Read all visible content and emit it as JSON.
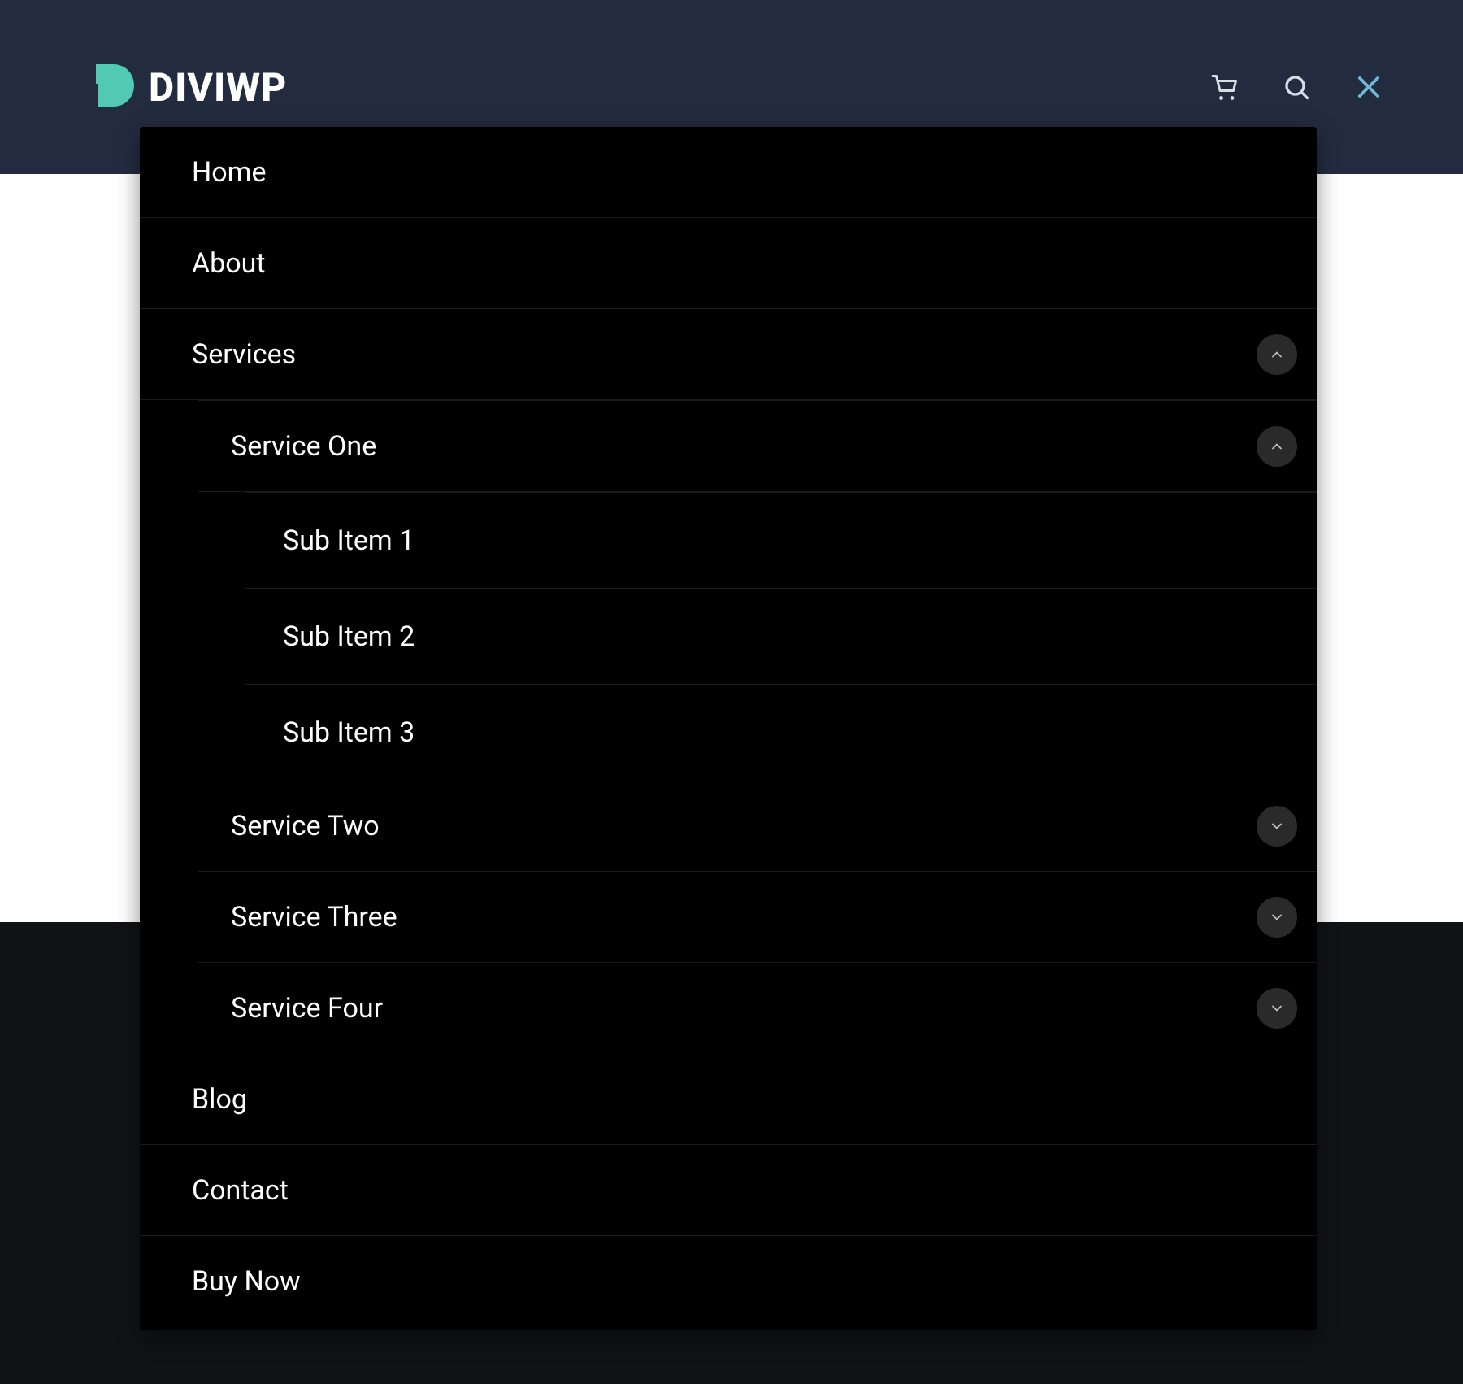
{
  "brand": {
    "name": "DIVIWP",
    "accent_color": "#52c9b3"
  },
  "header": {
    "icons": {
      "cart": "cart-icon",
      "search": "search-icon",
      "close": "close-icon"
    }
  },
  "menu": {
    "items": [
      {
        "label": "Home"
      },
      {
        "label": "About"
      },
      {
        "label": "Services",
        "expanded": true,
        "children": [
          {
            "label": "Service One",
            "expanded": true,
            "children": [
              {
                "label": "Sub Item 1"
              },
              {
                "label": "Sub Item 2"
              },
              {
                "label": "Sub Item 3"
              }
            ]
          },
          {
            "label": "Service Two",
            "expanded": false,
            "children": []
          },
          {
            "label": "Service Three",
            "expanded": false,
            "children": []
          },
          {
            "label": "Service Four",
            "expanded": false,
            "children": []
          }
        ]
      },
      {
        "label": "Blog"
      },
      {
        "label": "Contact"
      },
      {
        "label": "Buy Now"
      }
    ]
  }
}
